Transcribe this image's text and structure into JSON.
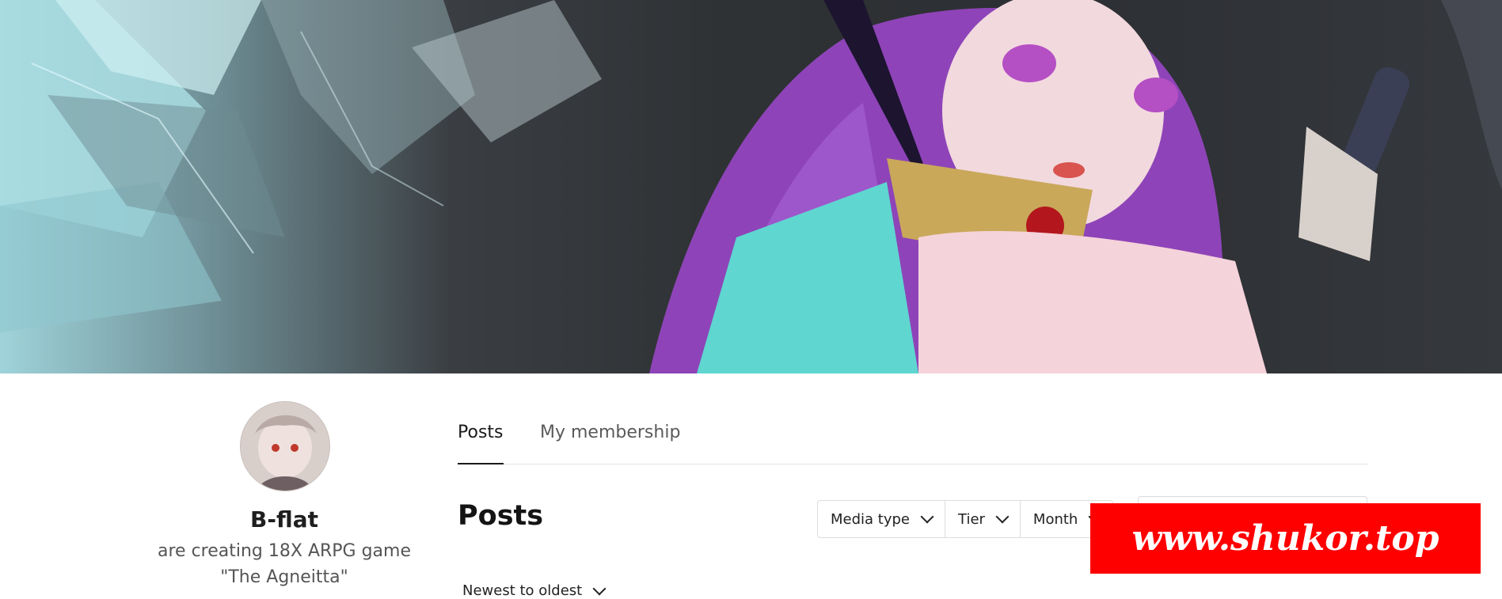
{
  "creator": {
    "name": "B-flat",
    "description_line1": "are creating 18X ARPG game",
    "description_line2": "\"The Agneitta\""
  },
  "tabs": [
    {
      "label": "Posts",
      "active": true
    },
    {
      "label": "My membership",
      "active": false
    }
  ],
  "posts": {
    "heading": "Posts",
    "filters": [
      {
        "label": "Media type"
      },
      {
        "label": "Tier"
      },
      {
        "label": "Month"
      }
    ],
    "sort_label": "Newest to oldest"
  },
  "watermark": {
    "text": "www.shukor.top",
    "color": "#ff0000"
  },
  "colors": {
    "banner_dark": "#2f3235",
    "accent_purple": "#9b4fc7",
    "accent_cyan": "#5fd6d0"
  }
}
